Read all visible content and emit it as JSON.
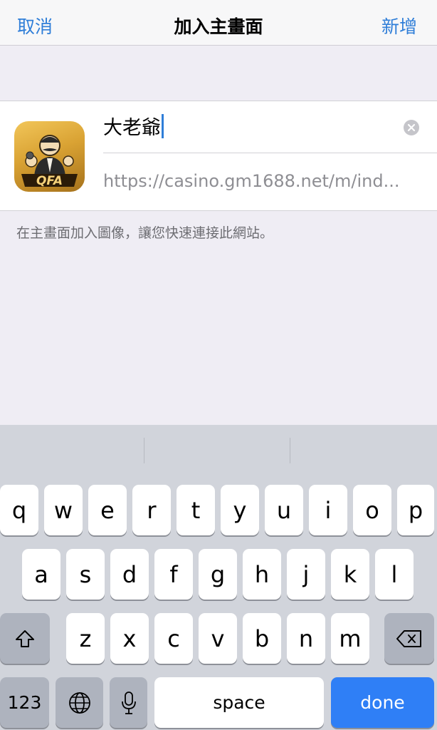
{
  "navbar": {
    "cancel": "取消",
    "title": "加入主畫面",
    "add": "新增"
  },
  "form": {
    "name_value": "大老爺",
    "url": "https://casino.gm1688.net/m/ind...",
    "hint": "在主畫面加入圖像，讓您快速連接此網站。",
    "icon_text": "QFA"
  },
  "keyboard": {
    "row1": [
      "q",
      "w",
      "e",
      "r",
      "t",
      "y",
      "u",
      "i",
      "o",
      "p"
    ],
    "row2": [
      "a",
      "s",
      "d",
      "f",
      "g",
      "h",
      "j",
      "k",
      "l"
    ],
    "row3": [
      "z",
      "x",
      "c",
      "v",
      "b",
      "n",
      "m"
    ],
    "numbers_label": "123",
    "space_label": "space",
    "done_label": "done"
  },
  "colors": {
    "accent": "#2f7ed8",
    "done_key": "#2f7ff6",
    "keyboard_bg": "#d1d4db"
  }
}
